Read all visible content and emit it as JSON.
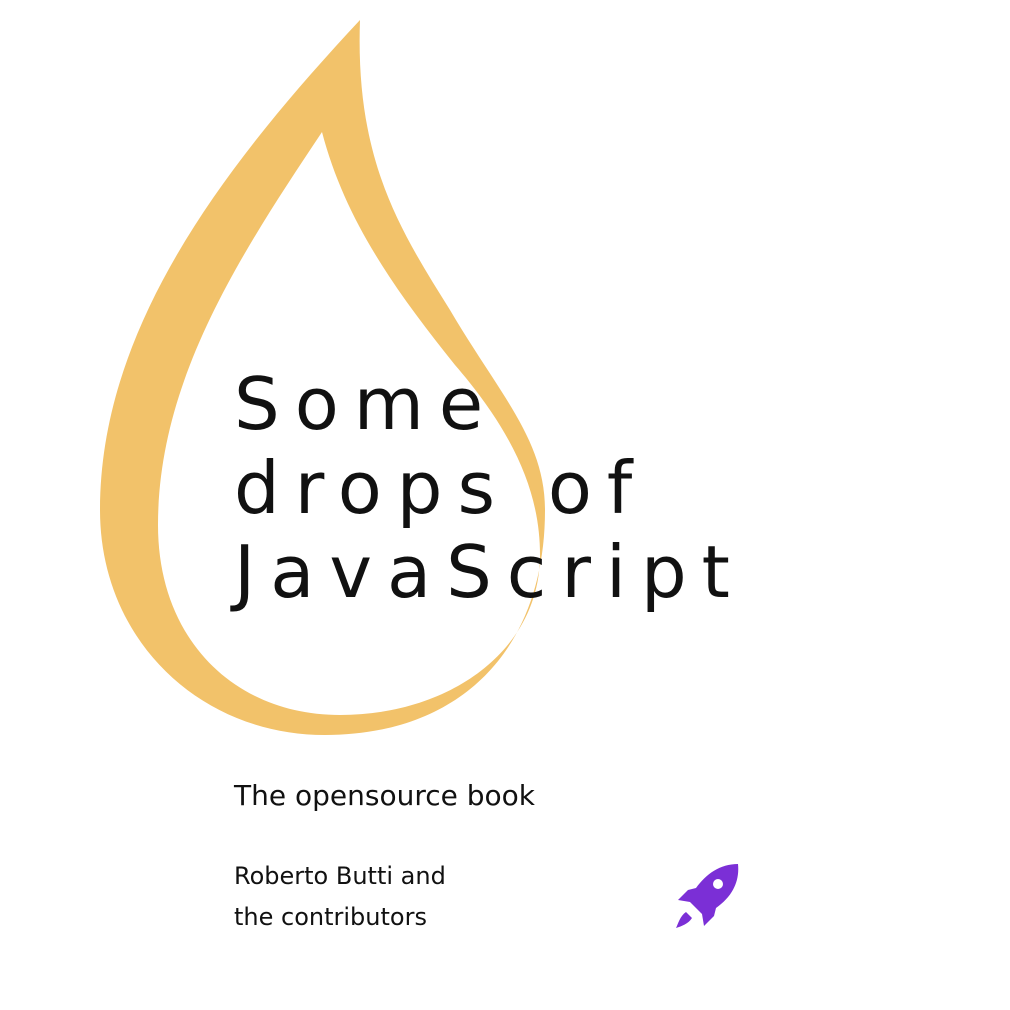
{
  "cover": {
    "title_lines": [
      "Some",
      "drops of",
      "JavaScript"
    ],
    "subtitle": "The opensource book",
    "author_lines": [
      "Roberto Butti and",
      "the contributors"
    ]
  },
  "colors": {
    "drop": "#F2C26A",
    "text": "#111111",
    "rocket": "#7B2FD6",
    "background": "#FFFFFF"
  },
  "icons": {
    "drop": "drop-logo-icon",
    "rocket": "rocket-icon"
  }
}
